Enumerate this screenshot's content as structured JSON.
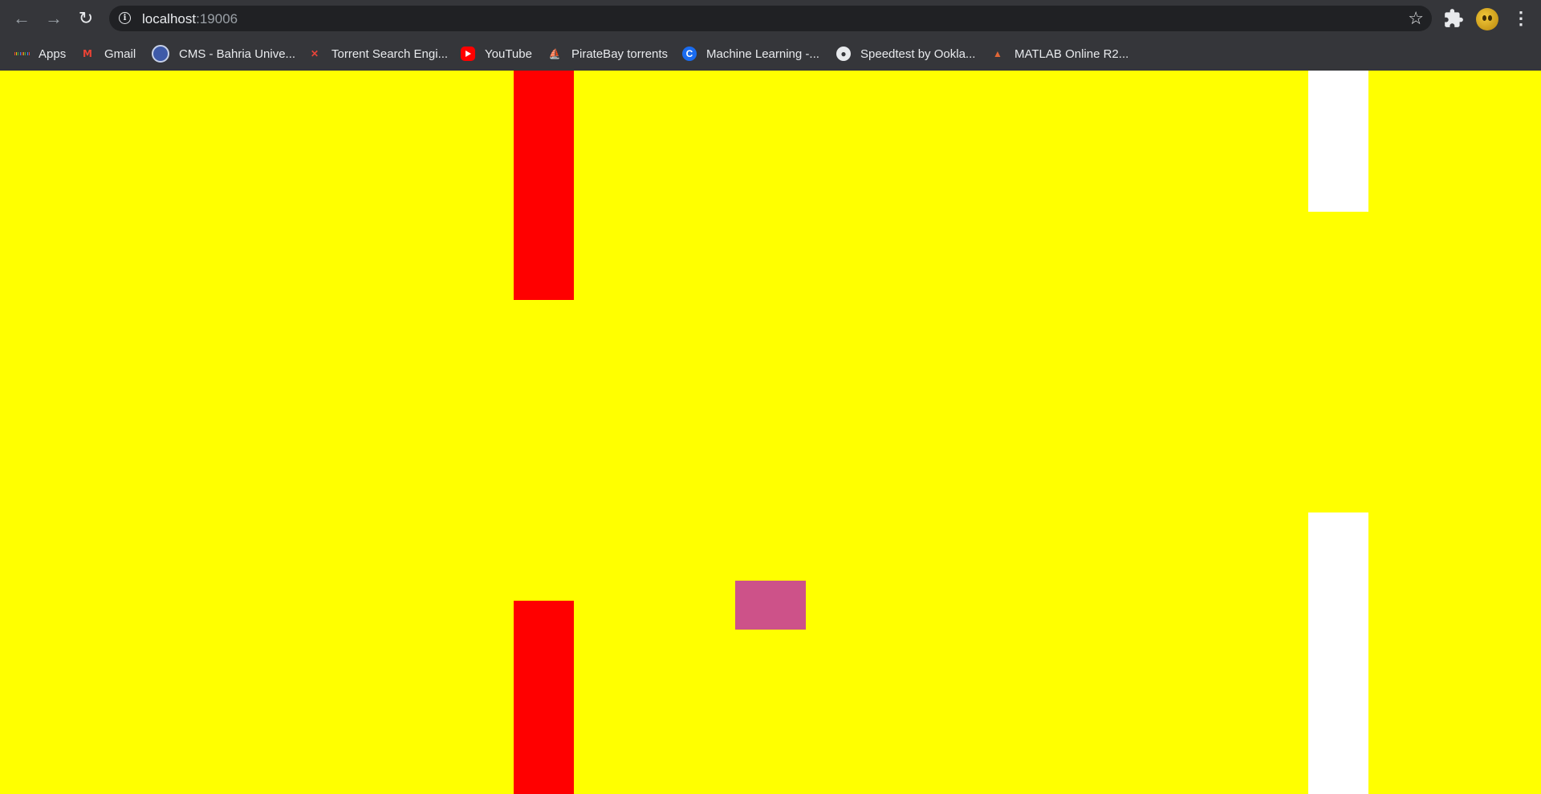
{
  "browser": {
    "url_host": "localhost",
    "url_port": ":19006",
    "icons": {
      "back": "back-arrow-icon",
      "forward": "forward-arrow-icon",
      "reload": "reload-icon",
      "info": "info-icon",
      "star": "star-icon",
      "extensions": "puzzle-icon",
      "menu": "kebab-menu-icon"
    },
    "info_glyph": "i",
    "star_glyph": "☆",
    "menu_glyph": "⋮",
    "back_glyph": "←",
    "forward_glyph": "→",
    "reload_glyph": "↻"
  },
  "bookmarks": [
    {
      "label": "Apps",
      "icon": "apps-grid-icon"
    },
    {
      "label": "Gmail",
      "icon": "gmail-icon",
      "glyph": "M"
    },
    {
      "label": "CMS - Bahria Unive...",
      "icon": "cms-icon"
    },
    {
      "label": "Torrent Search Engi...",
      "icon": "torrent-icon",
      "glyph": "✕"
    },
    {
      "label": "YouTube",
      "icon": "youtube-icon"
    },
    {
      "label": "PirateBay torrents",
      "icon": "pirate-ship-icon",
      "glyph": "⛵"
    },
    {
      "label": "Machine Learning -...",
      "icon": "coursera-icon",
      "glyph": "C"
    },
    {
      "label": "Speedtest by Ookla...",
      "icon": "globe-icon",
      "glyph": "●"
    },
    {
      "label": "MATLAB Online R2...",
      "icon": "matlab-icon",
      "glyph": "▲"
    }
  ],
  "game": {
    "background_color": "#ffff00",
    "obstacle_colors": {
      "red": "#ff0000",
      "white": "#ffffff"
    },
    "player_color": "#cd5289"
  }
}
